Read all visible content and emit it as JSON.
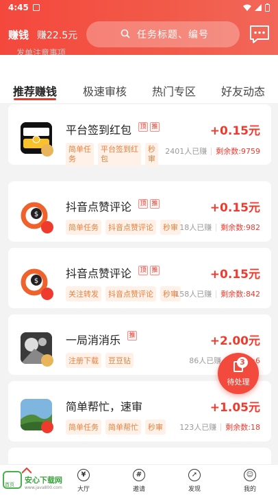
{
  "status_bar": {
    "time": "4:45"
  },
  "header": {
    "brand": "赚钱",
    "earned": "赚22.5元",
    "search_placeholder": "任务标题、编号"
  },
  "notice": "发单注意事项",
  "tabs": [
    "推荐赚钱",
    "极速审核",
    "热门专区",
    "好友动态"
  ],
  "active_tab": "推荐赚钱",
  "tasks": [
    {
      "title": "平台签到红包",
      "flags": [
        "顶",
        "推"
      ],
      "reward": "+0.15元",
      "tags": [
        "简单任\n务",
        "平台签到红\n包",
        "秒\n审"
      ],
      "made": "2401人已赚",
      "left": "剩余数:9759",
      "icon": "laicaibang-icon"
    },
    {
      "title": "抖音点赞评论",
      "flags": [
        "顶",
        "推"
      ],
      "reward": "+0.15元",
      "tags": [
        "简单任务",
        "抖音点赞评论",
        "秒审"
      ],
      "made": "18人已赚",
      "left": "剩余数:982",
      "icon": "dollar-app-icon"
    },
    {
      "title": "抖音点赞评论",
      "flags": [
        "顶",
        "推"
      ],
      "reward": "+0.15元",
      "tags": [
        "关注转发",
        "抖音点赞评论",
        "秒审"
      ],
      "made": "158人已赚",
      "left": "剩余数:842",
      "icon": "dollar-app-icon"
    },
    {
      "title": "一局消消乐",
      "flags": [
        "推"
      ],
      "reward": "+2.00元",
      "tags": [
        "注册下载",
        "豆豆钻"
      ],
      "made": "86人已赚",
      "left": "剩余数:6",
      "icon": "game-icon"
    },
    {
      "title": "简单帮忙，速审",
      "flags": [],
      "reward": "+1.05元",
      "tags": [
        "简单任务",
        "简单帮忙",
        "秒审"
      ],
      "made": "123人已赚",
      "left": "剩余数:18",
      "icon": "landscape-icon"
    }
  ],
  "fab": {
    "badge": "3",
    "label": "待处理"
  },
  "bottom_nav": [
    "大厅",
    "邀请",
    "发现",
    "我的"
  ],
  "watermark": {
    "text": "安心下载网",
    "sub": "www.java800.com",
    "logo_text": "首页"
  },
  "colors": {
    "accent": "#ee3b2e",
    "tag_text": "#e9823f",
    "tag_bg": "#fff1e8"
  }
}
